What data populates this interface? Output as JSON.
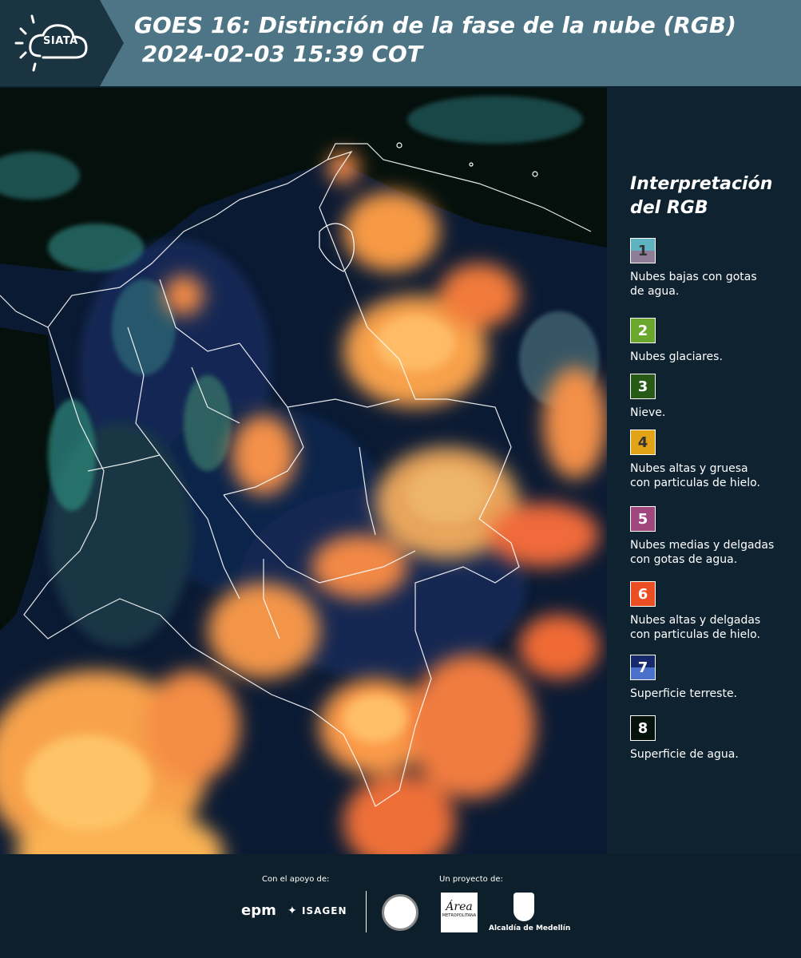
{
  "header": {
    "logo_text": "SIATA",
    "title": "GOES 16: Distinción de la fase de la nube (RGB)\n 2024-02-03 15:39 COT"
  },
  "legend": {
    "title": "Interpretación del RGB",
    "items": [
      {
        "number": "1",
        "label": "Nubes bajas con gotas\nde agua.",
        "color_top": "#5fb2bf",
        "color_bottom": "#8d7d96",
        "number_color": "#333333"
      },
      {
        "number": "2",
        "label": "Nubes glaciares.",
        "color_top": "#6aa72d",
        "color_bottom": "#6aa72d",
        "number_color": "#ffffff"
      },
      {
        "number": "3",
        "label": "Nieve.",
        "color_top": "#275a17",
        "color_bottom": "#275a17",
        "number_color": "#ffffff"
      },
      {
        "number": "4",
        "label": "Nubes altas y gruesa\ncon particulas de hielo.",
        "color_top": "#e2a317",
        "color_bottom": "#e2a317",
        "number_color": "#333333"
      },
      {
        "number": "5",
        "label": "Nubes medias y delgadas\ncon gotas de agua.",
        "color_top": "#a0477e",
        "color_bottom": "#a0477e",
        "number_color": "#ffffff"
      },
      {
        "number": "6",
        "label": "Nubes altas y delgadas\ncon particulas de hielo.",
        "color_top": "#eb4e23",
        "color_bottom": "#eb4e23",
        "number_color": "#ffffff"
      },
      {
        "number": "7",
        "label": "Superficie terreste.",
        "color_top": "#15296b",
        "color_bottom": "#4a70c9",
        "number_color": "#ffffff"
      },
      {
        "number": "8",
        "label": "Superficie de agua.",
        "color_top": "#06120c",
        "color_bottom": "#06120c",
        "number_color": "#ffffff"
      }
    ]
  },
  "footer": {
    "support_label": "Con el apoyo de:",
    "project_label": "Un proyecto de:",
    "epm": "epm",
    "isagen": "ISAGEN",
    "area": "Área",
    "area_sub": "METROPOLITANA",
    "alcaldia": "Alcaldía de Medellín"
  }
}
